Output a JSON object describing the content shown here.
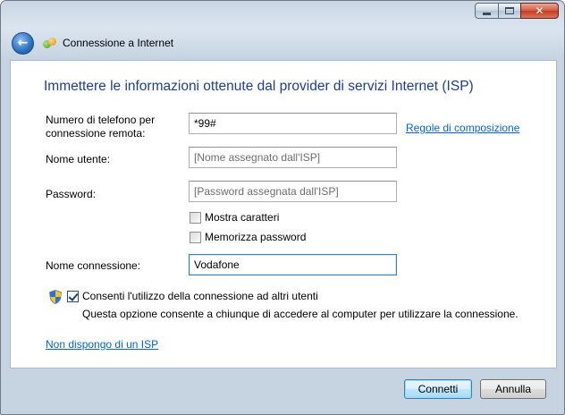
{
  "window": {
    "title": "Connessione a Internet"
  },
  "icons": {
    "back": "back-arrow-icon",
    "app": "network-globe-icon",
    "shield": "uac-shield-icon"
  },
  "form": {
    "heading": "Immettere le informazioni ottenute dal provider di servizi Internet (ISP)",
    "phone_label_line1": "Numero di telefono per",
    "phone_label_line2": "connessione remota:",
    "phone_value": "*99#",
    "dialing_rules_link": "Regole di composizione",
    "username_label": "Nome utente:",
    "username_placeholder": "[Nome assegnato dall'ISP]",
    "password_label": "Password:",
    "password_placeholder": "[Password assegnata dall'ISP]",
    "show_chars_label": "Mostra caratteri",
    "show_chars_checked": false,
    "remember_password_label": "Memorizza password",
    "remember_password_checked": false,
    "connection_name_label": "Nome connessione:",
    "connection_name_value": "Vodafone",
    "allow_others_label": "Consenti l'utilizzo della connessione ad altri utenti",
    "allow_others_checked": true,
    "allow_others_note": "Questa opzione consente a chiunque di accedere al computer per utilizzare la connessione.",
    "no_isp_link": "Non dispongo di un ISP"
  },
  "buttons": {
    "connect": "Connetti",
    "cancel": "Annulla"
  },
  "colors": {
    "heading": "#1e3e8f",
    "link": "#0066cc"
  }
}
